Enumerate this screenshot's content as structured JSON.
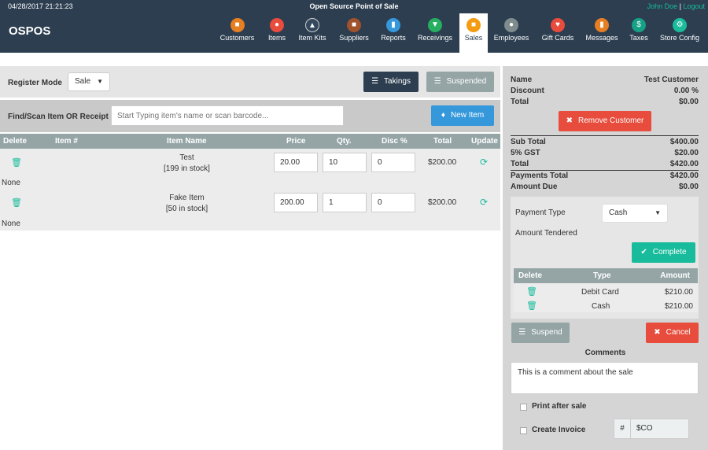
{
  "topbar": {
    "datetime": "04/28/2017 21:21:23",
    "app_name": "Open Source Point of Sale",
    "user": "John Doe",
    "separator": " | ",
    "logout": "Logout"
  },
  "brand": "OSPOS",
  "nav": [
    {
      "label": "Customers",
      "icon": "customers-icon",
      "color": "#e67e22"
    },
    {
      "label": "Items",
      "icon": "items-icon",
      "color": "#e74c3c"
    },
    {
      "label": "Item Kits",
      "icon": "item-kits-icon",
      "color": "#34495e"
    },
    {
      "label": "Suppliers",
      "icon": "suppliers-icon",
      "color": "#a0522d"
    },
    {
      "label": "Reports",
      "icon": "reports-icon",
      "color": "#3498db"
    },
    {
      "label": "Receivings",
      "icon": "receivings-icon",
      "color": "#27ae60"
    },
    {
      "label": "Sales",
      "icon": "sales-icon",
      "color": "#f39c12",
      "active": true
    },
    {
      "label": "Employees",
      "icon": "employees-icon",
      "color": "#7f8c8d"
    },
    {
      "label": "Gift Cards",
      "icon": "gift-cards-icon",
      "color": "#e74c3c"
    },
    {
      "label": "Messages",
      "icon": "messages-icon",
      "color": "#e67e22"
    },
    {
      "label": "Taxes",
      "icon": "taxes-icon",
      "color": "#16a085"
    },
    {
      "label": "Store Config",
      "icon": "store-config-icon",
      "color": "#1abc9c"
    }
  ],
  "register": {
    "mode_label": "Register Mode",
    "mode_value": "Sale",
    "takings_label": "Takings",
    "suspended_label": "Suspended"
  },
  "find": {
    "label": "Find/Scan Item OR Receipt",
    "placeholder": "Start Typing item's name or scan barcode...",
    "new_item_label": "New Item"
  },
  "cart": {
    "headers": [
      "Delete",
      "Item #",
      "Item Name",
      "Price",
      "Qty.",
      "Disc %",
      "Total",
      "Update"
    ],
    "rows": [
      {
        "name": "Test",
        "stock": "[199 in stock]",
        "price": "20.00",
        "qty": "10",
        "disc": "0",
        "total": "$200.00",
        "serial": "None"
      },
      {
        "name": "Fake Item",
        "stock": "[50 in stock]",
        "price": "200.00",
        "qty": "1",
        "disc": "0",
        "total": "$200.00",
        "serial": "None"
      }
    ]
  },
  "customer": {
    "name_label": "Name",
    "name": "Test Customer",
    "discount_label": "Discount",
    "discount": "0.00 %",
    "total_label": "Total",
    "total": "$0.00",
    "remove_label": "Remove Customer"
  },
  "summary": [
    {
      "label": "Sub Total",
      "value": "$400.00"
    },
    {
      "label": "5% GST",
      "value": "$20.00"
    },
    {
      "label": "Total",
      "value": "$420.00"
    },
    {
      "label": "Payments Total",
      "value": "$420.00"
    },
    {
      "label": "Amount Due",
      "value": "$0.00"
    }
  ],
  "payment": {
    "type_label": "Payment Type",
    "type_value": "Cash",
    "tendered_label": "Amount Tendered",
    "complete_label": "Complete"
  },
  "payments": {
    "headers": [
      "Delete",
      "Type",
      "Amount"
    ],
    "rows": [
      {
        "type": "Debit Card",
        "amount": "$210.00"
      },
      {
        "type": "Cash",
        "amount": "$210.00"
      }
    ]
  },
  "actions": {
    "suspend_label": "Suspend",
    "cancel_label": "Cancel"
  },
  "comments": {
    "label": "Comments",
    "text": "This is a comment about the sale"
  },
  "options": {
    "print_label": "Print after sale",
    "invoice_label": "Create Invoice",
    "invoice_prefix": "#",
    "invoice_value": "$CO"
  }
}
